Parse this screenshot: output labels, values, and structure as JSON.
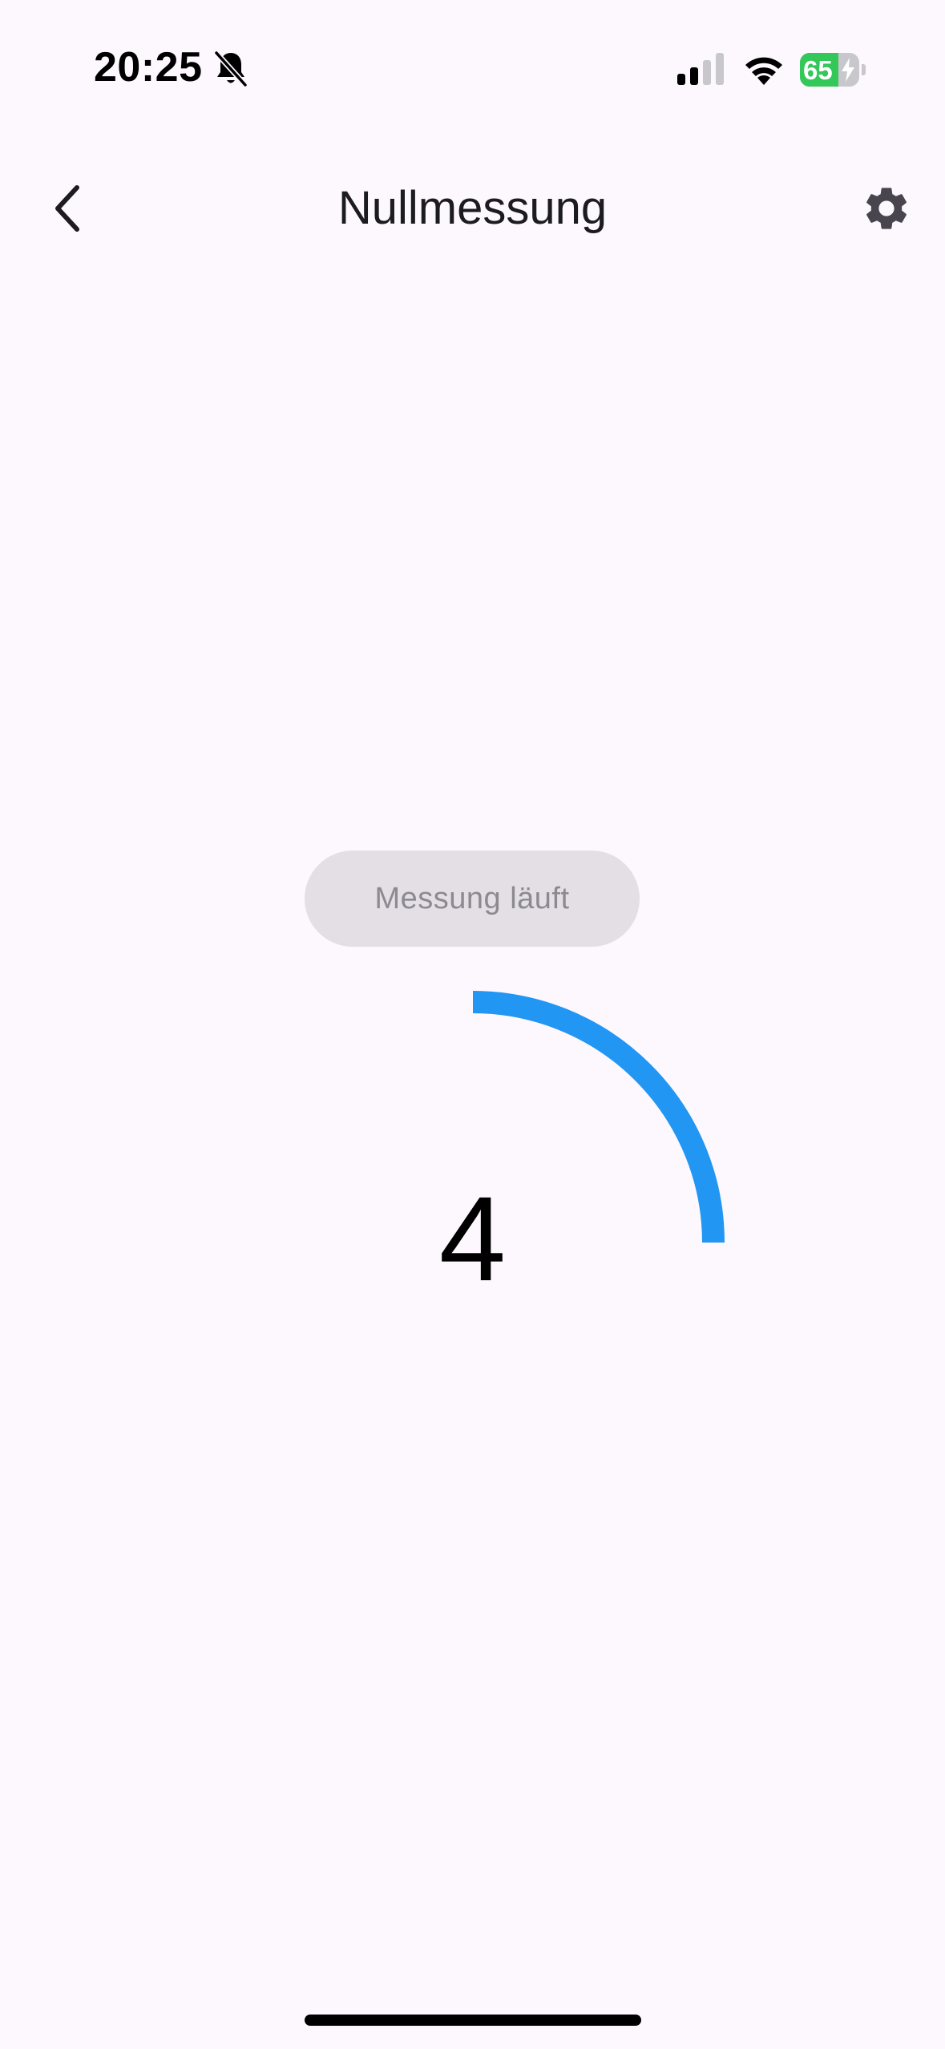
{
  "status_bar": {
    "time": "20:25",
    "battery_level": "65",
    "battery_fraction": 0.65,
    "icons": [
      "bell-slash-icon",
      "cellular-signal-icon",
      "wifi-icon",
      "battery-charging-icon"
    ]
  },
  "app_bar": {
    "title": "Nullmessung",
    "back_icon": "chevron-left-icon",
    "settings_icon": "gear-icon"
  },
  "measurement": {
    "status_label": "Messung läuft",
    "countdown": "4",
    "progress_fraction": 0.25,
    "progress_color": "#2196f3"
  },
  "colors": {
    "background": "#fdf7fe",
    "pill_background": "#e3dfe5",
    "pill_text": "#8c8a90",
    "battery_green": "#34c759"
  }
}
